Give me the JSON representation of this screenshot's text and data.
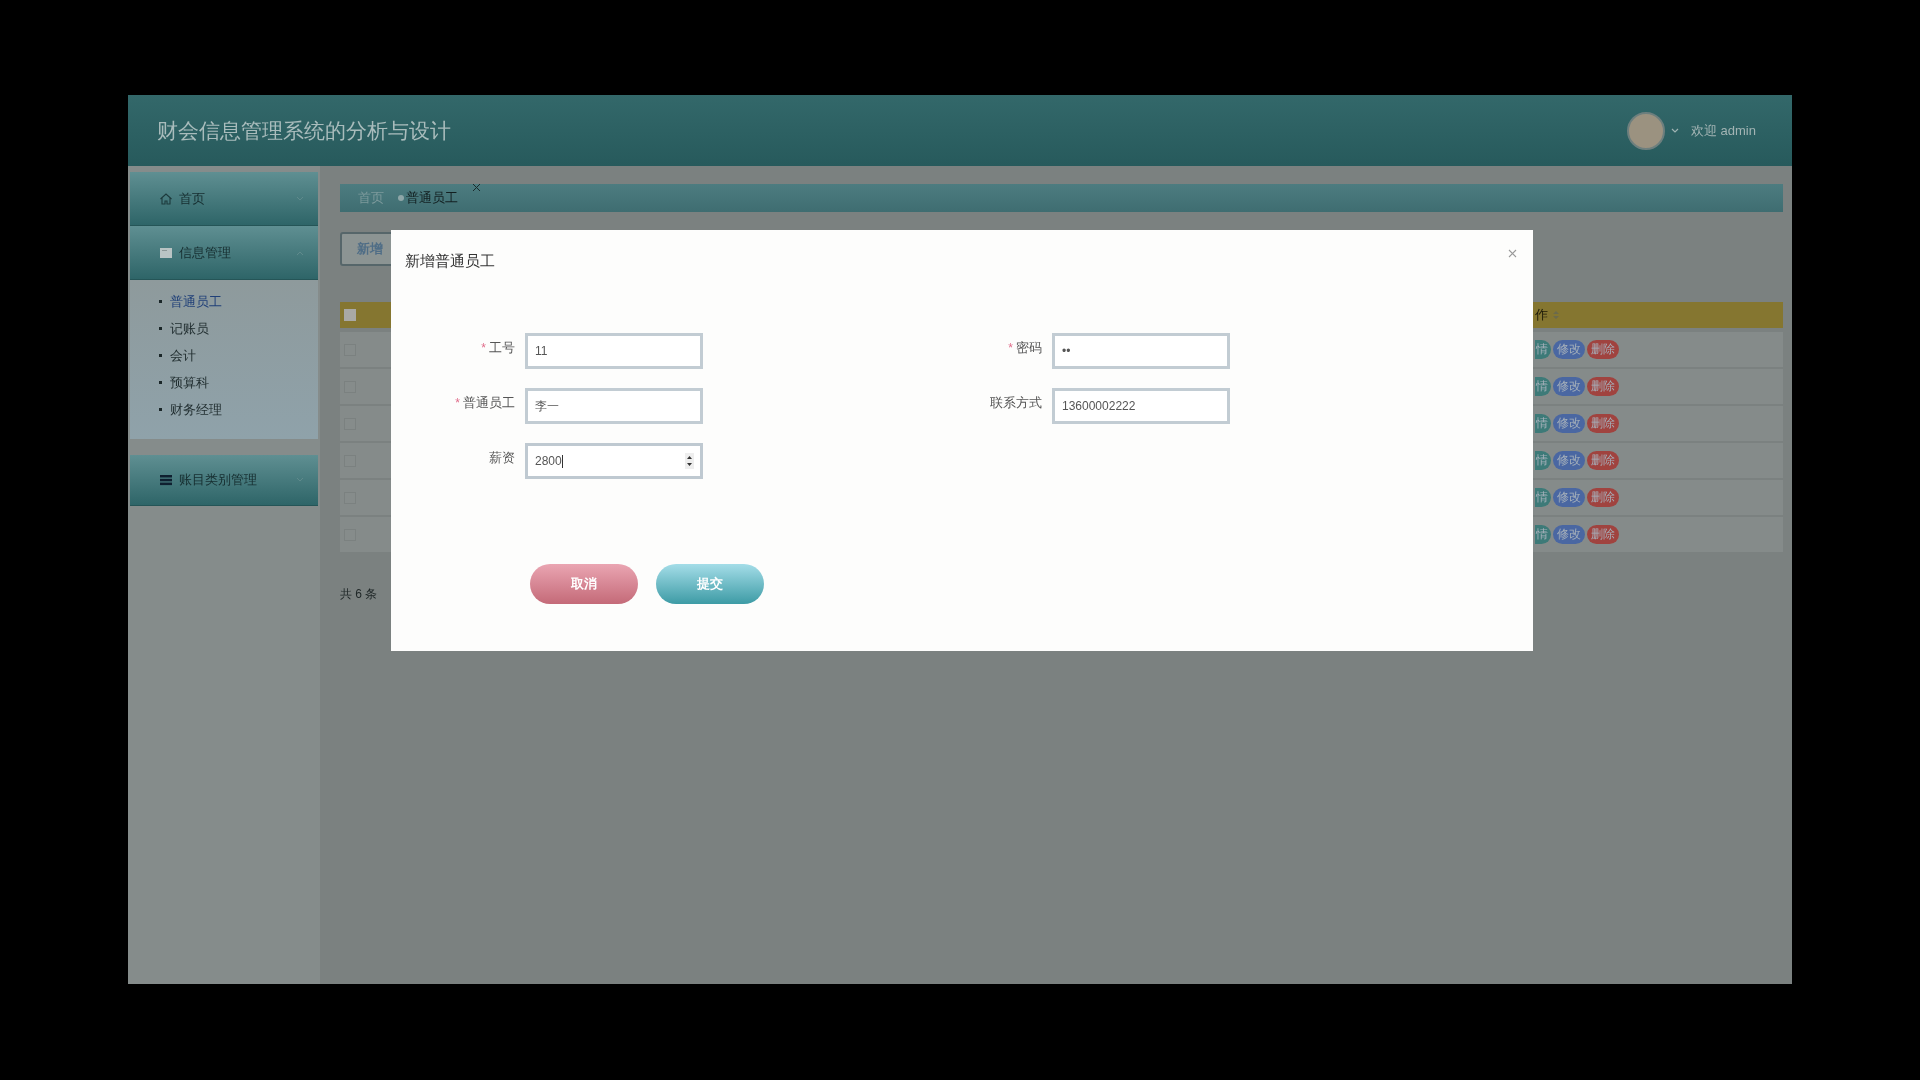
{
  "header": {
    "title": "财会信息管理系统的分析与设计",
    "greeting": "欢迎 admin"
  },
  "sidebar": {
    "items": [
      {
        "label": "首页",
        "expanded": false
      },
      {
        "label": "信息管理",
        "expanded": true,
        "children": [
          {
            "label": "普通员工",
            "selected": true
          },
          {
            "label": "记账员",
            "selected": false
          },
          {
            "label": "会计",
            "selected": false
          },
          {
            "label": "预算科",
            "selected": false
          },
          {
            "label": "财务经理",
            "selected": false
          }
        ]
      },
      {
        "label": "账目类别管理",
        "expanded": false
      }
    ]
  },
  "tabs": [
    {
      "label": "首页",
      "selected": false,
      "closable": false
    },
    {
      "label": "普通员工",
      "selected": true,
      "closable": true
    }
  ],
  "toolbar": {
    "buttons": [
      "新增"
    ]
  },
  "table": {
    "header": {
      "checked": false,
      "column_label": "作"
    },
    "rows": [
      {
        "checked": false,
        "actions": [
          {
            "label": "情",
            "kind": "detail"
          },
          {
            "label": "修改",
            "kind": "edit"
          },
          {
            "label": "删除",
            "kind": "delete"
          }
        ]
      },
      {
        "checked": false,
        "actions": [
          {
            "label": "情",
            "kind": "detail"
          },
          {
            "label": "修改",
            "kind": "edit"
          },
          {
            "label": "删除",
            "kind": "delete"
          }
        ]
      },
      {
        "checked": false,
        "actions": [
          {
            "label": "情",
            "kind": "detail"
          },
          {
            "label": "修改",
            "kind": "edit"
          },
          {
            "label": "删除",
            "kind": "delete"
          }
        ]
      },
      {
        "checked": false,
        "actions": [
          {
            "label": "情",
            "kind": "detail"
          },
          {
            "label": "修改",
            "kind": "edit"
          },
          {
            "label": "删除",
            "kind": "delete"
          }
        ]
      },
      {
        "checked": false,
        "actions": [
          {
            "label": "情",
            "kind": "detail"
          },
          {
            "label": "修改",
            "kind": "edit"
          },
          {
            "label": "删除",
            "kind": "delete"
          }
        ]
      },
      {
        "checked": false,
        "actions": [
          {
            "label": "情",
            "kind": "detail"
          },
          {
            "label": "修改",
            "kind": "edit"
          },
          {
            "label": "删除",
            "kind": "delete"
          }
        ]
      }
    ],
    "footer": "共 6 条"
  },
  "dialog": {
    "title": "新增普通员工",
    "fields": [
      {
        "label": "工号",
        "required_mark": "*",
        "kind": "text",
        "value": "11",
        "focused": false
      },
      {
        "label": "密码",
        "required_mark": "*",
        "kind": "password",
        "value": "••",
        "focused": false
      },
      {
        "label": "普通员工",
        "required_mark": "*",
        "kind": "text",
        "value": "李一",
        "focused": false
      },
      {
        "label": "联系方式",
        "kind": "text",
        "value": "13600002222",
        "focused": false
      },
      {
        "label": "薪资",
        "kind": "number",
        "value": "2800",
        "focused": true
      }
    ],
    "buttons": [
      {
        "label": "取消",
        "kind": "cancel"
      },
      {
        "label": "提交",
        "kind": "submit"
      }
    ]
  }
}
